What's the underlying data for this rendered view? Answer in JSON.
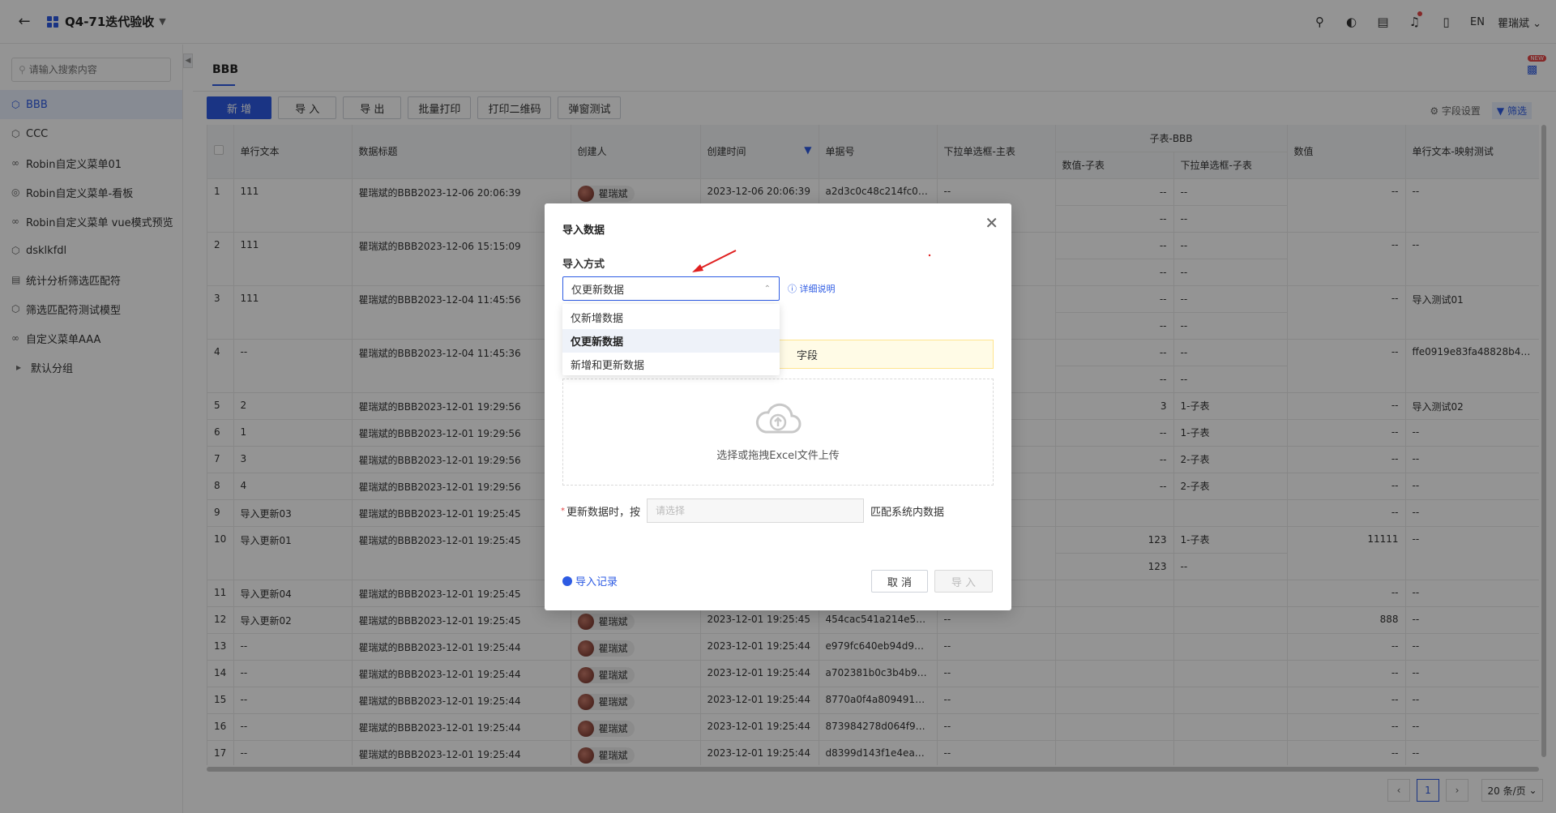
{
  "header": {
    "app_title": "Q4-71迭代验收",
    "language": "EN",
    "user_name": "瞿瑞斌"
  },
  "sidebar": {
    "search_placeholder": "请输入搜索内容",
    "items": [
      {
        "label": "BBB",
        "active": true
      },
      {
        "label": "CCC"
      },
      {
        "label": "Robin自定义菜单01"
      },
      {
        "label": "Robin自定义菜单-看板"
      },
      {
        "label": "Robin自定义菜单 vue模式预览"
      },
      {
        "label": "dsklkfdl"
      },
      {
        "label": "统计分析筛选匹配符"
      },
      {
        "label": "筛选匹配符测试模型"
      },
      {
        "label": "自定义菜单AAA"
      },
      {
        "label": "默认分组"
      }
    ]
  },
  "main": {
    "tab_title": "BBB",
    "new_badge": "NEW",
    "toolbar": {
      "add": "新 增",
      "import": "导 入",
      "export": "导 出",
      "batch_print": "批量打印",
      "print_qr": "打印二维码",
      "popup_test": "弹窗测试",
      "field_settings": "字段设置",
      "filter": "筛选"
    },
    "table": {
      "headers": {
        "single_text": "单行文本",
        "data_title": "数据标题",
        "creator": "创建人",
        "created_time": "创建时间",
        "doc_no": "单据号",
        "dropdown_main": "下拉单选框-主表",
        "subtable_group": "子表-BBB",
        "sub_value": "数值-子表",
        "sub_dropdown": "下拉单选框-子表",
        "value": "数值",
        "single_text_map": "单行文本-映射测试"
      },
      "rows": [
        {
          "no": "1",
          "text": "111",
          "title": "瞿瑞斌的BBB2023-12-06 20:06:39",
          "creator": "瞿瑞斌",
          "time": "2023-12-06 20:06:39",
          "doc": "a2d3c0c48c214fc08c...",
          "dd": "--",
          "sub": [
            [
              "--",
              "--"
            ],
            [
              "--",
              "--"
            ]
          ],
          "value": "--",
          "map": "--"
        },
        {
          "no": "2",
          "text": "111",
          "title": "瞿瑞斌的BBB2023-12-06 15:15:09",
          "creator": "",
          "time": "",
          "doc": "",
          "dd": "",
          "sub": [
            [
              "--",
              "--"
            ],
            [
              "--",
              "--"
            ]
          ],
          "value": "--",
          "map": "--"
        },
        {
          "no": "3",
          "text": "111",
          "title": "瞿瑞斌的BBB2023-12-04 11:45:56",
          "creator": "",
          "time": "",
          "doc": "",
          "dd": "",
          "sub": [
            [
              "--",
              "--"
            ],
            [
              "--",
              "--"
            ]
          ],
          "value": "--",
          "map": "导入测试01"
        },
        {
          "no": "4",
          "text": "--",
          "title": "瞿瑞斌的BBB2023-12-04 11:45:36",
          "creator": "",
          "time": "",
          "doc": "",
          "dd": "",
          "sub": [
            [
              "--",
              "--"
            ],
            [
              "--",
              "--"
            ]
          ],
          "value": "--",
          "map": "ffe0919e83fa48828b44d2d..."
        },
        {
          "no": "5",
          "text": "2",
          "title": "瞿瑞斌的BBB2023-12-01 19:29:56",
          "creator": "",
          "time": "",
          "doc": "",
          "dd": "",
          "sub": [
            [
              "3",
              "1-子表"
            ]
          ],
          "value": "--",
          "map": "导入测试02"
        },
        {
          "no": "6",
          "text": "1",
          "title": "瞿瑞斌的BBB2023-12-01 19:29:56",
          "creator": "",
          "time": "",
          "doc": "",
          "dd": "",
          "sub": [
            [
              "--",
              "1-子表"
            ]
          ],
          "value": "--",
          "map": "--"
        },
        {
          "no": "7",
          "text": "3",
          "title": "瞿瑞斌的BBB2023-12-01 19:29:56",
          "creator": "",
          "time": "",
          "doc": "",
          "dd": "",
          "sub": [
            [
              "--",
              "2-子表"
            ]
          ],
          "value": "--",
          "map": "--"
        },
        {
          "no": "8",
          "text": "4",
          "title": "瞿瑞斌的BBB2023-12-01 19:29:56",
          "creator": "",
          "time": "",
          "doc": "",
          "dd": "",
          "sub": [
            [
              "--",
              "2-子表"
            ]
          ],
          "value": "--",
          "map": "--"
        },
        {
          "no": "9",
          "text": "导入更新03",
          "title": "瞿瑞斌的BBB2023-12-01 19:25:45",
          "creator": "",
          "time": "",
          "doc": "",
          "dd": "",
          "sub": [
            [
              "",
              ""
            ]
          ],
          "value": "--",
          "map": "--"
        },
        {
          "no": "10",
          "text": "导入更新01",
          "title": "瞿瑞斌的BBB2023-12-01 19:25:45",
          "creator": "",
          "time": "",
          "doc": "",
          "dd": "",
          "sub": [
            [
              "123",
              "1-子表"
            ],
            [
              "123",
              "--"
            ]
          ],
          "value": "11111",
          "map": "--"
        },
        {
          "no": "11",
          "text": "导入更新04",
          "title": "瞿瑞斌的BBB2023-12-01 19:25:45",
          "creator": "",
          "time": "",
          "doc": "",
          "dd": "",
          "sub": [
            [
              "",
              ""
            ]
          ],
          "value": "--",
          "map": "--"
        },
        {
          "no": "12",
          "text": "导入更新02",
          "title": "瞿瑞斌的BBB2023-12-01 19:25:45",
          "creator": "瞿瑞斌",
          "time": "2023-12-01 19:25:45",
          "doc": "454cac541a214e508c...",
          "dd": "--",
          "sub": [
            [
              "",
              ""
            ]
          ],
          "value": "888",
          "map": "--"
        },
        {
          "no": "13",
          "text": "--",
          "title": "瞿瑞斌的BBB2023-12-01 19:25:44",
          "creator": "瞿瑞斌",
          "time": "2023-12-01 19:25:44",
          "doc": "e979fc640eb94d9b9c...",
          "dd": "--",
          "sub": [
            [
              "",
              ""
            ]
          ],
          "value": "--",
          "map": "--"
        },
        {
          "no": "14",
          "text": "--",
          "title": "瞿瑞斌的BBB2023-12-01 19:25:44",
          "creator": "瞿瑞斌",
          "time": "2023-12-01 19:25:44",
          "doc": "a702381b0c3b4b99a...",
          "dd": "--",
          "sub": [
            [
              "",
              ""
            ]
          ],
          "value": "--",
          "map": "--"
        },
        {
          "no": "15",
          "text": "--",
          "title": "瞿瑞斌的BBB2023-12-01 19:25:44",
          "creator": "瞿瑞斌",
          "time": "2023-12-01 19:25:44",
          "doc": "8770a0f4a809491db...",
          "dd": "--",
          "sub": [
            [
              "",
              ""
            ]
          ],
          "value": "--",
          "map": "--"
        },
        {
          "no": "16",
          "text": "--",
          "title": "瞿瑞斌的BBB2023-12-01 19:25:44",
          "creator": "瞿瑞斌",
          "time": "2023-12-01 19:25:44",
          "doc": "873984278d064f918...",
          "dd": "--",
          "sub": [
            [
              "",
              ""
            ]
          ],
          "value": "--",
          "map": "--"
        },
        {
          "no": "17",
          "text": "--",
          "title": "瞿瑞斌的BBB2023-12-01 19:25:44",
          "creator": "瞿瑞斌",
          "time": "2023-12-01 19:25:44",
          "doc": "d8399d143f1e4ea2b...",
          "dd": "--",
          "sub": [
            [
              "",
              ""
            ]
          ],
          "value": "--",
          "map": "--"
        }
      ]
    },
    "pagination": {
      "current": "1",
      "page_size": "20 条/页"
    }
  },
  "modal": {
    "title": "导入数据",
    "method_label": "导入方式",
    "selected": "仅更新数据",
    "help": "详细说明",
    "options": [
      "仅新增数据",
      "仅更新数据",
      "新增和更新数据"
    ],
    "warning_tail": "字段",
    "upload_text": "选择或拖拽Excel文件上传",
    "match_prefix": "更新数据时，按",
    "match_placeholder": "请选择",
    "match_suffix": "匹配系统内数据",
    "records": "导入记录",
    "cancel": "取 消",
    "import": "导 入"
  },
  "colors": {
    "accent": "#2d5be3",
    "danger": "#e54545"
  }
}
